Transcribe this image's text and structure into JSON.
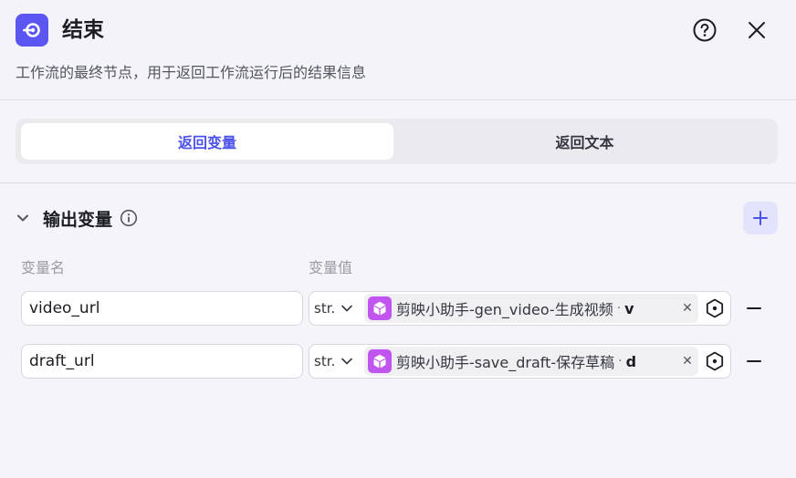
{
  "header": {
    "title": "结束",
    "description": "工作流的最终节点，用于返回工作流运行后的结果信息",
    "help_icon": "question-circle-icon",
    "close_icon": "close-icon",
    "logo_icon": "end-node-icon"
  },
  "tabs": [
    {
      "label": "返回变量",
      "active": true
    },
    {
      "label": "返回文本",
      "active": false
    }
  ],
  "output_section": {
    "title": "输出变量",
    "info_icon": "info-icon",
    "add_icon": "plus-icon",
    "columns": {
      "name": "变量名",
      "value": "变量值"
    },
    "rows": [
      {
        "name": "video_url",
        "type": "str.",
        "ref_source": "剪映小助手-gen_video-生成视频",
        "ref_sep": "·",
        "ref_field": "v"
      },
      {
        "name": "draft_url",
        "type": "str.",
        "ref_source": "剪映小助手-save_draft-保存草稿",
        "ref_sep": "·",
        "ref_field": "d"
      }
    ]
  },
  "colors": {
    "accent": "#4d53e8",
    "logo_bg": "#5b56f2",
    "plugin_icon_bg": "#c155f0",
    "add_button_bg": "#e3e4fb"
  }
}
